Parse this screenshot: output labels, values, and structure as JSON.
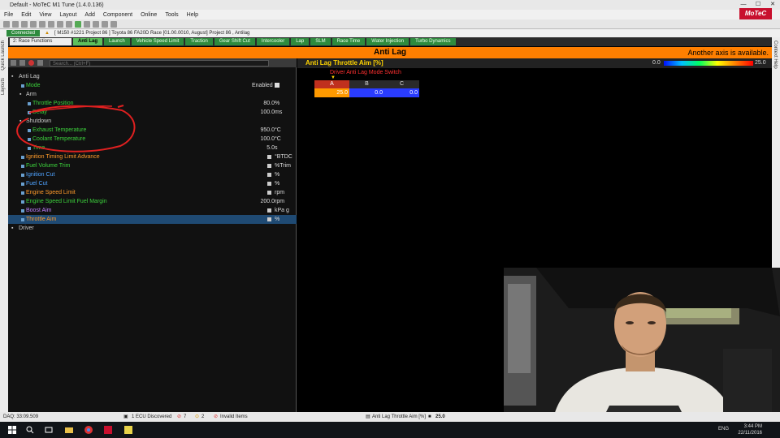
{
  "window": {
    "title": "Default - MoTeC M1 Tune (1.4.0.136)",
    "controls": [
      "—",
      "☐",
      "✕"
    ]
  },
  "menu": [
    "File",
    "Edit",
    "View",
    "Layout",
    "Add",
    "Component",
    "Online",
    "Tools",
    "Help"
  ],
  "brand": "MoTeC",
  "status_line": {
    "connection": "Connected",
    "project": "[ M150 #1221 Project 86 ]   Toyota 86 FA20D Race [01.00.0010, August] Project 86 , Antilag"
  },
  "side_tabs": {
    "left_1": "Quick Launch",
    "left_2": "Layouts",
    "right": "Context Help"
  },
  "workbook_select": "2: Race Functions",
  "tabs": [
    "Anti Lag",
    "Launch",
    "Vehicle Speed Limit",
    "Traction",
    "Gear Shift Cut",
    "Intercooler",
    "Lap",
    "SLM",
    "Race Time",
    "Water Injection",
    "Turbo Dynamics"
  ],
  "active_tab": "Anti Lag",
  "header_bar": {
    "title": "Anti Lag",
    "notice": "Another axis is available."
  },
  "search_placeholder": "Search... (Ctrl+F)",
  "tree": {
    "root": "Anti Lag",
    "mode": {
      "label": "Mode",
      "value": "Enabled"
    },
    "arm": "Arm",
    "throttle_position": {
      "label": "Throttle Position",
      "value": "80.0",
      "unit": "%"
    },
    "delay": {
      "label": "Delay",
      "value": "100.0",
      "unit": "ms"
    },
    "shutdown": "Shutdown",
    "exhaust_temp": {
      "label": "Exhaust Temperature",
      "value": "950.0",
      "unit": "°C"
    },
    "coolant_temp": {
      "label": "Coolant Temperature",
      "value": "100.0",
      "unit": "°C"
    },
    "time": {
      "label": "Time",
      "value": "5.0",
      "unit": "s"
    },
    "ign_timing": {
      "label": "Ignition Timing Limit Advance",
      "unit": "°BTDC"
    },
    "fuel_volume": {
      "label": "Fuel Volume Trim",
      "unit": "%Trim"
    },
    "ign_cut": {
      "label": "Ignition Cut",
      "unit": "%"
    },
    "fuel_cut": {
      "label": "Fuel Cut",
      "unit": "%"
    },
    "eng_speed_limit": {
      "label": "Engine Speed Limit",
      "unit": "rpm"
    },
    "eng_speed_margin": {
      "label": "Engine Speed Limit Fuel Margin",
      "value": "200.0",
      "unit": "rpm"
    },
    "boost_aim": {
      "label": "Boost Aim",
      "unit": "kPa g"
    },
    "throttle_aim": {
      "label": "Throttle Aim",
      "unit": "%"
    },
    "driver": "Driver"
  },
  "table": {
    "title": "Anti Lag Throttle Aim [%]",
    "scale_min": "0.0",
    "scale_max": "25.0",
    "axis_label": "Driver Anti Lag Mode Switch",
    "columns": [
      "A",
      "B",
      "C"
    ],
    "values": [
      "25.0",
      "0.0",
      "0.0"
    ],
    "value_fraction": [
      1.0,
      0.0,
      0.0
    ]
  },
  "statusbar": {
    "daq": "DAQ: 33:09.509",
    "ecu": "1 ECU Discovered",
    "errors": "7",
    "warnings": "2",
    "invalid": "Invalid Items",
    "channel": "Anti Lag Throttle Aim [%]",
    "channel_value": "25.0"
  },
  "taskbar": {
    "lang": "ENG",
    "time": "3:44 PM",
    "date": "22/11/2016"
  },
  "colors": {
    "active_tab": "#5cc05c",
    "header_orange": "#ff7f00",
    "selected_row": "#1f4a73",
    "axis_active": "#c0301e"
  }
}
